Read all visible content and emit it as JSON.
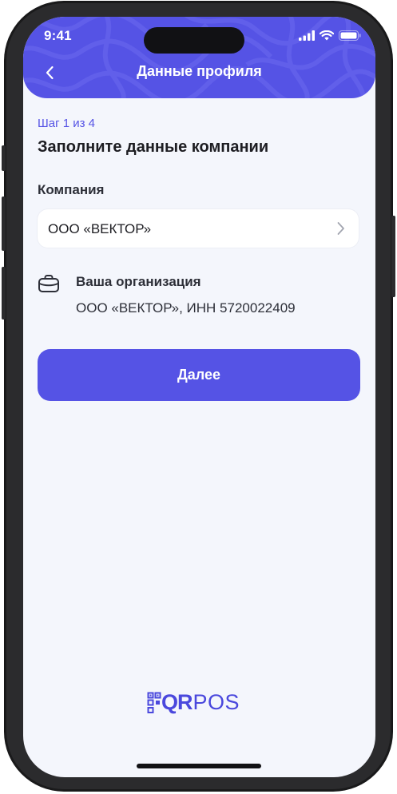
{
  "status_bar": {
    "time": "9:41"
  },
  "header": {
    "title": "Данные профиля",
    "color": "#5553e5"
  },
  "form": {
    "step": "Шаг 1 из 4",
    "title": "Заполните данные компании",
    "company_label": "Компания",
    "company_value": "ООО «ВЕКТОР»",
    "org_title": "Ваша организация",
    "org_details": "ООО «ВЕКТОР», ИНН 5720022409",
    "next_button": "Далее"
  },
  "brand": {
    "qr": "QR",
    "pos": "POS",
    "color": "#4a48dd"
  },
  "icons": {
    "back": "chevron-left-icon",
    "select": "chevron-right-icon",
    "organization": "briefcase-icon",
    "signal": "signal-icon",
    "wifi": "wifi-icon",
    "battery": "battery-icon"
  }
}
